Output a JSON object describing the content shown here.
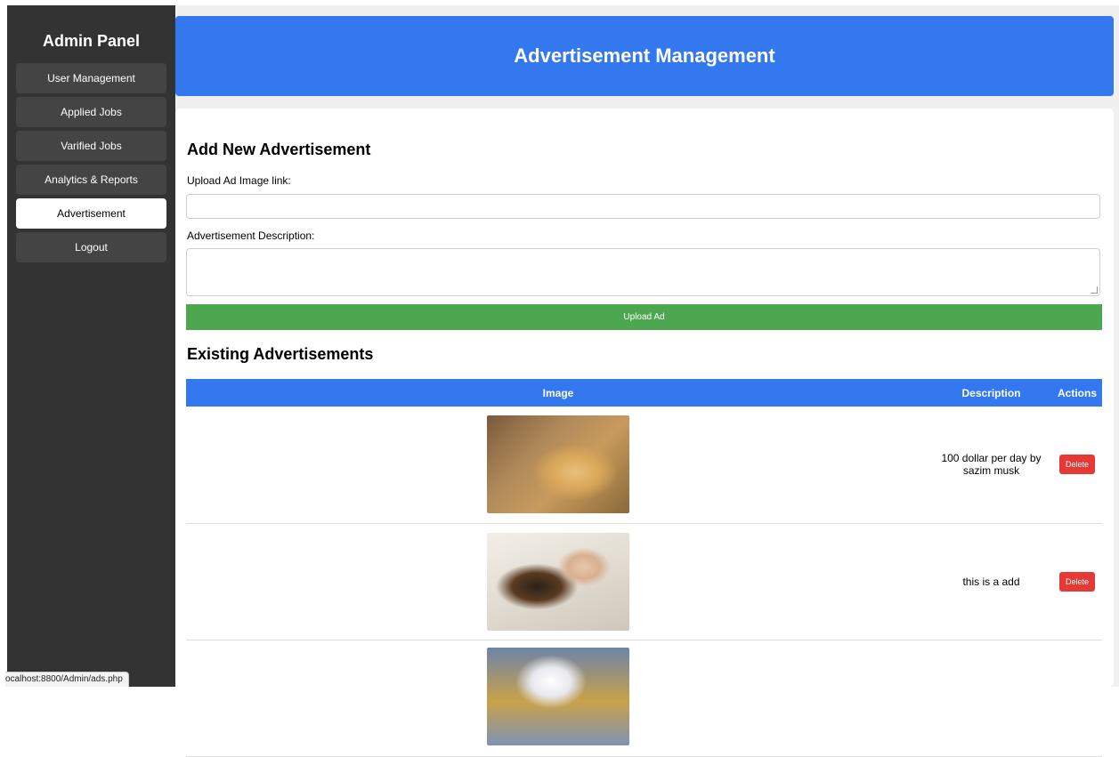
{
  "sidebar": {
    "title": "Admin Panel",
    "items": [
      {
        "label": "User Management",
        "active": false
      },
      {
        "label": "Applied Jobs",
        "active": false
      },
      {
        "label": "Varified Jobs",
        "active": false
      },
      {
        "label": "Analytics & Reports",
        "active": false
      },
      {
        "label": "Advertisement",
        "active": true
      },
      {
        "label": "Logout",
        "active": false
      }
    ]
  },
  "status_bar": {
    "url": "ocalhost:8800/Admin/ads.php"
  },
  "header": {
    "title": "Advertisement Management"
  },
  "form": {
    "title": "Add New Advertisement",
    "image_link_label": "Upload Ad Image link:",
    "image_link_value": "",
    "description_label": "Advertisement Description:",
    "description_value": "",
    "upload_button": "Upload Ad"
  },
  "existing": {
    "title": "Existing Advertisements",
    "columns": [
      "Image",
      "Description",
      "Actions"
    ],
    "rows": [
      {
        "image": "golden-retriever-photo",
        "description": "100 dollar per day by sazim musk",
        "action": "Delete"
      },
      {
        "image": "child-and-dog-sleeping-photo",
        "description": "this is a add",
        "action": "Delete"
      },
      {
        "image": "dalmatian-dog-photo",
        "description": "",
        "action": ""
      }
    ]
  },
  "colors": {
    "sidebar_bg": "#333333",
    "header_bg": "#3478f0",
    "upload_button": "#4da650",
    "delete_button": "#e53935"
  }
}
